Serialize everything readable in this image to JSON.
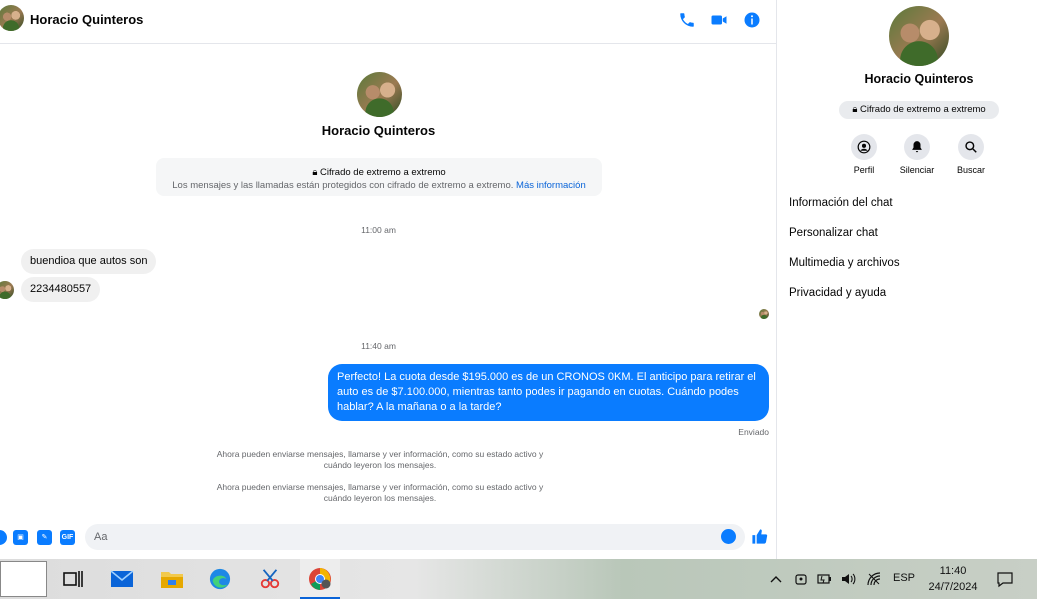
{
  "header": {
    "contact_name": "Horacio Quinteros",
    "icons": [
      "phone-icon",
      "video-icon",
      "info-icon"
    ]
  },
  "conversation": {
    "contact_name": "Horacio Quinteros",
    "e2e_title": "Cifrado de extremo a extremo",
    "e2e_text": "Los mensajes y las llamadas están protegidos con cifrado de extremo a extremo.",
    "e2e_link": "Más información",
    "timestamp1": "11:00 am",
    "msg_in_1": "buendioa que autos son",
    "msg_in_2": "2234480557",
    "timestamp2": "11:40 am",
    "msg_out_1": "Perfecto! La cuota desde $195.000 es de un CRONOS 0KM. El anticipo para retirar el auto es de $7.100.000, mientras tanto podes ir pagando en cuotas. Cuándo podes hablar? A la mañana o a la tarde?",
    "sent_label": "Enviado",
    "system_msg_1": "Ahora pueden enviarse mensajes, llamarse y ver información, como su estado activo y cuándo leyeron los mensajes.",
    "system_msg_2": "Ahora pueden enviarse mensajes, llamarse y ver información, como su estado activo y cuándo leyeron los mensajes."
  },
  "composer": {
    "placeholder": "Aa",
    "gif_label": "GIF"
  },
  "side": {
    "contact_name": "Horacio Quinteros",
    "e2e_badge": "Cifrado de extremo a extremo",
    "actions": {
      "profile": "Perfil",
      "mute": "Silenciar",
      "search": "Buscar"
    },
    "menu": [
      "Información del chat",
      "Personalizar chat",
      "Multimedia y archivos",
      "Privacidad y ayuda"
    ]
  },
  "taskbar": {
    "lang": "ESP",
    "time": "11:40",
    "date": "24/7/2024"
  },
  "colors": {
    "accent": "#0a7cff",
    "bubble_in": "#f0f0f0"
  }
}
